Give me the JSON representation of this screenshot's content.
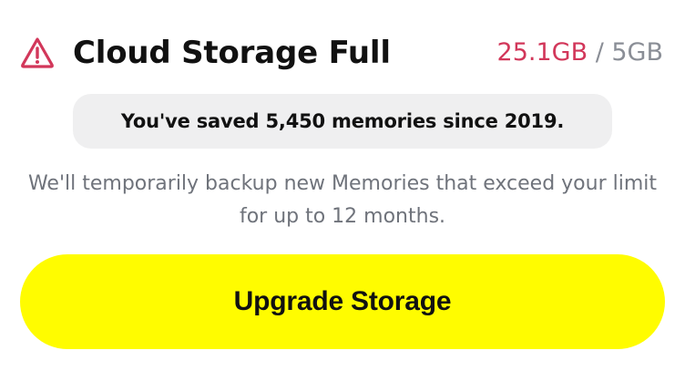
{
  "header": {
    "icon": "warning-triangle-icon",
    "title": "Cloud Storage Full",
    "usage": {
      "used": "25.1GB",
      "separator": " / ",
      "limit": "5GB"
    }
  },
  "summary": {
    "text": "You've saved 5,450 memories since 2019."
  },
  "description": {
    "text": "We'll temporarily backup new Memories that exceed your limit for up to 12 months."
  },
  "cta": {
    "label": "Upgrade Storage"
  },
  "colors": {
    "accent_red": "#d2375a",
    "button_yellow": "#fffc00",
    "muted_text": "#6f737b",
    "pill_bg": "#efeff0"
  }
}
